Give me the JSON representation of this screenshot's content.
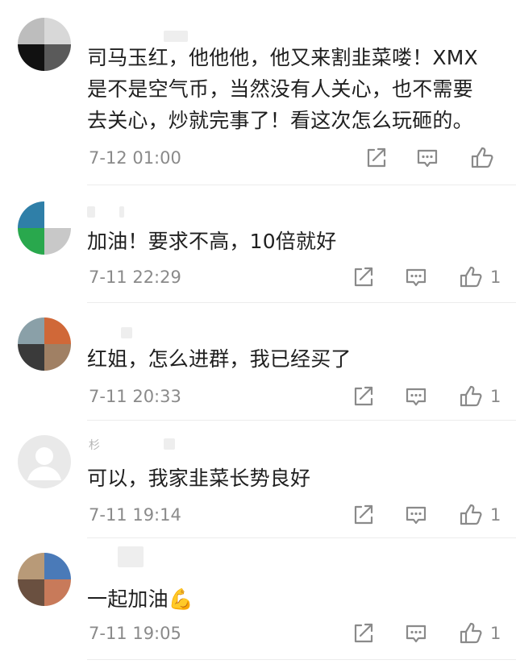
{
  "comments": [
    {
      "content": "司马玉红，他他他，他又来割韭菜喽！XMX\n是不是空气币，当然没有人关心，也不需要\n去关心，炒就完事了！看这次怎么玩砸的。",
      "time": "7-12 01:00",
      "likes": ""
    },
    {
      "content": "加油！要求不高，10倍就好",
      "time": "7-11 22:29",
      "likes": "1"
    },
    {
      "content": "红姐，怎么进群，我已经买了",
      "time": "7-11 20:33",
      "likes": "1"
    },
    {
      "username_fragment": "杉",
      "content": "可以，我家韭菜长势良好",
      "time": "7-11 19:14",
      "likes": "1"
    },
    {
      "content": "一起加油💪",
      "time": "7-11 19:05",
      "likes": "1"
    }
  ],
  "icons": {
    "share": "share-icon",
    "reply": "comment-icon",
    "like": "thumbs-up-icon"
  },
  "colors": {
    "text": "#1f1f1f",
    "meta": "#8a8a8a",
    "icon": "#8a8a8a",
    "divider": "#ececec"
  }
}
